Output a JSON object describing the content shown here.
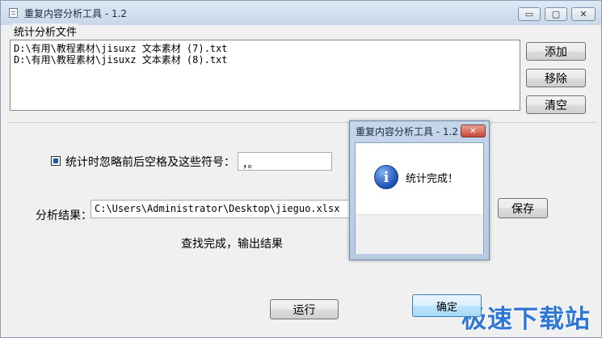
{
  "window": {
    "title": "重复内容分析工具 - 1.2",
    "controls": {
      "minimize": "▭",
      "maximize": "▢",
      "close": "✕"
    }
  },
  "files_group": {
    "label": "统计分析文件",
    "files": [
      "D:\\有用\\教程素材\\jisuxz 文本素材 (7).txt",
      "D:\\有用\\教程素材\\jisuxz 文本素材 (8).txt"
    ],
    "buttons": {
      "add": "添加",
      "remove": "移除",
      "clear": "清空"
    }
  },
  "options": {
    "ignore_checked": true,
    "ignore_label": "统计时忽略前后空格及这些符号：",
    "symbols_value": "，。"
  },
  "result": {
    "label": "分析结果：",
    "path_value": "C:\\Users\\Administrator\\Desktop\\jieguo.xlsx",
    "save_button": "保存"
  },
  "status": "查找完成，输出结果",
  "run_button": "运行",
  "watermark": "极速下载站",
  "dialog": {
    "title": "重复内容分析工具 - 1.2",
    "close": "✕",
    "icon": "info-icon",
    "icon_glyph": "i",
    "message": "统计完成！",
    "ok_button": "确定"
  },
  "colors": {
    "accent": "#2f77d4",
    "dialog_close": "#c9473a"
  }
}
